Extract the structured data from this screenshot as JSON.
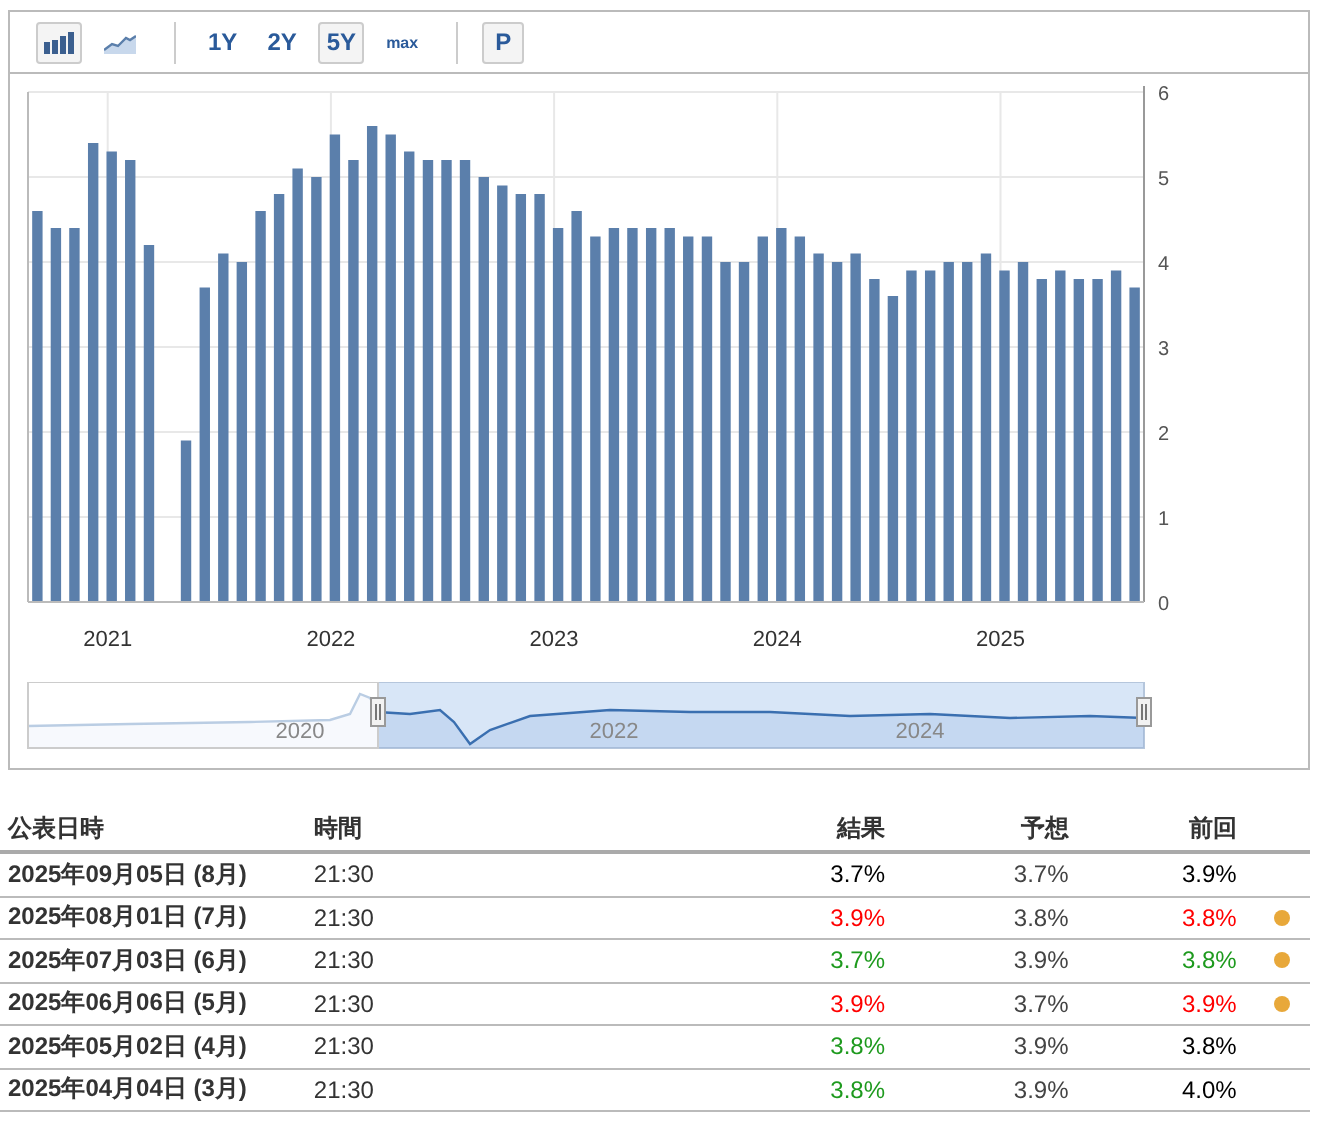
{
  "toolbar": {
    "chart_types": [
      {
        "kind": "bar",
        "selected": true
      },
      {
        "kind": "area",
        "selected": false
      }
    ],
    "ranges": [
      {
        "label": "1Y",
        "selected": false
      },
      {
        "label": "2Y",
        "selected": false
      },
      {
        "label": "5Y",
        "selected": true
      },
      {
        "label": "max",
        "selected": false,
        "small": true
      }
    ],
    "p_button": "P"
  },
  "chart_data": {
    "type": "bar",
    "grid": true,
    "x": [
      2020.667,
      2020.75,
      2020.833,
      2020.917,
      2021,
      2021.083,
      2021.167,
      2021.25,
      2021.333,
      2021.417,
      2021.5,
      2021.583,
      2021.667,
      2021.75,
      2021.833,
      2021.917,
      2022,
      2022.083,
      2022.167,
      2022.25,
      2022.333,
      2022.417,
      2022.5,
      2022.583,
      2022.667,
      2022.75,
      2022.833,
      2022.917,
      2023,
      2023.083,
      2023.167,
      2023.25,
      2023.333,
      2023.417,
      2023.5,
      2023.583,
      2023.667,
      2023.75,
      2023.833,
      2023.917,
      2024,
      2024.083,
      2024.167,
      2024.25,
      2024.333,
      2024.417,
      2024.5,
      2024.583,
      2024.667,
      2024.75,
      2024.833,
      2024.917,
      2025,
      2025.083,
      2025.167,
      2025.25,
      2025.333,
      2025.417,
      2025.5,
      2025.583
    ],
    "xlim": [
      2020.625,
      2025.625
    ],
    "series": [
      {
        "color": "#5b7fab",
        "values": [
          4.6,
          4.4,
          4.4,
          5.4,
          5.3,
          5.2,
          4.2,
          null,
          1.9,
          3.7,
          4.1,
          4.0,
          4.6,
          4.8,
          5.1,
          5.0,
          5.5,
          5.2,
          5.6,
          5.5,
          5.3,
          5.2,
          5.2,
          5.2,
          5.0,
          4.9,
          4.8,
          4.8,
          4.4,
          4.6,
          4.3,
          4.4,
          4.4,
          4.4,
          4.4,
          4.3,
          4.3,
          4.0,
          4.0,
          4.3,
          4.4,
          4.3,
          4.1,
          4.0,
          4.1,
          3.8,
          3.6,
          3.9,
          3.9,
          4.0,
          4.0,
          4.1,
          3.9,
          4.0,
          3.8,
          3.9,
          3.8,
          3.8,
          3.9,
          3.7
        ]
      }
    ],
    "ylim": [
      0,
      6
    ],
    "yticks": [
      0,
      1,
      2,
      3,
      4,
      5,
      6
    ],
    "xticks": [
      2021,
      2022,
      2023,
      2024,
      2025
    ]
  },
  "navigator": {
    "year_labels": [
      "2020",
      "2022",
      "2024"
    ]
  },
  "table": {
    "columns": [
      "公表日時",
      "時間",
      "結果",
      "予想",
      "前回"
    ],
    "rows": [
      {
        "date": "2025年09月05日 (8月)",
        "time": "21:30",
        "actual": {
          "text": "3.7%",
          "color": "#000000"
        },
        "forecast": "3.7%",
        "previous": {
          "text": "3.9%",
          "color": "#000000"
        }
      },
      {
        "date": "2025年08月01日 (7月)",
        "time": "21:30",
        "actual": {
          "text": "3.9%",
          "color": "#ff0000"
        },
        "forecast": "3.8%",
        "previous": {
          "text": "3.8%",
          "color": "#ff0000"
        },
        "revised": true
      },
      {
        "date": "2025年07月03日 (6月)",
        "time": "21:30",
        "actual": {
          "text": "3.7%",
          "color": "#1e9a1e"
        },
        "forecast": "3.9%",
        "previous": {
          "text": "3.8%",
          "color": "#1e9a1e"
        },
        "revised": true
      },
      {
        "date": "2025年06月06日 (5月)",
        "time": "21:30",
        "actual": {
          "text": "3.9%",
          "color": "#ff0000"
        },
        "forecast": "3.7%",
        "previous": {
          "text": "3.9%",
          "color": "#ff0000"
        },
        "revised": true
      },
      {
        "date": "2025年05月02日 (4月)",
        "time": "21:30",
        "actual": {
          "text": "3.8%",
          "color": "#1e9a1e"
        },
        "forecast": "3.9%",
        "previous": {
          "text": "3.8%",
          "color": "#000000"
        }
      },
      {
        "date": "2025年04月04日 (3月)",
        "time": "21:30",
        "actual": {
          "text": "3.8%",
          "color": "#1e9a1e"
        },
        "forecast": "3.9%",
        "previous": {
          "text": "4.0%",
          "color": "#000000"
        }
      }
    ]
  }
}
